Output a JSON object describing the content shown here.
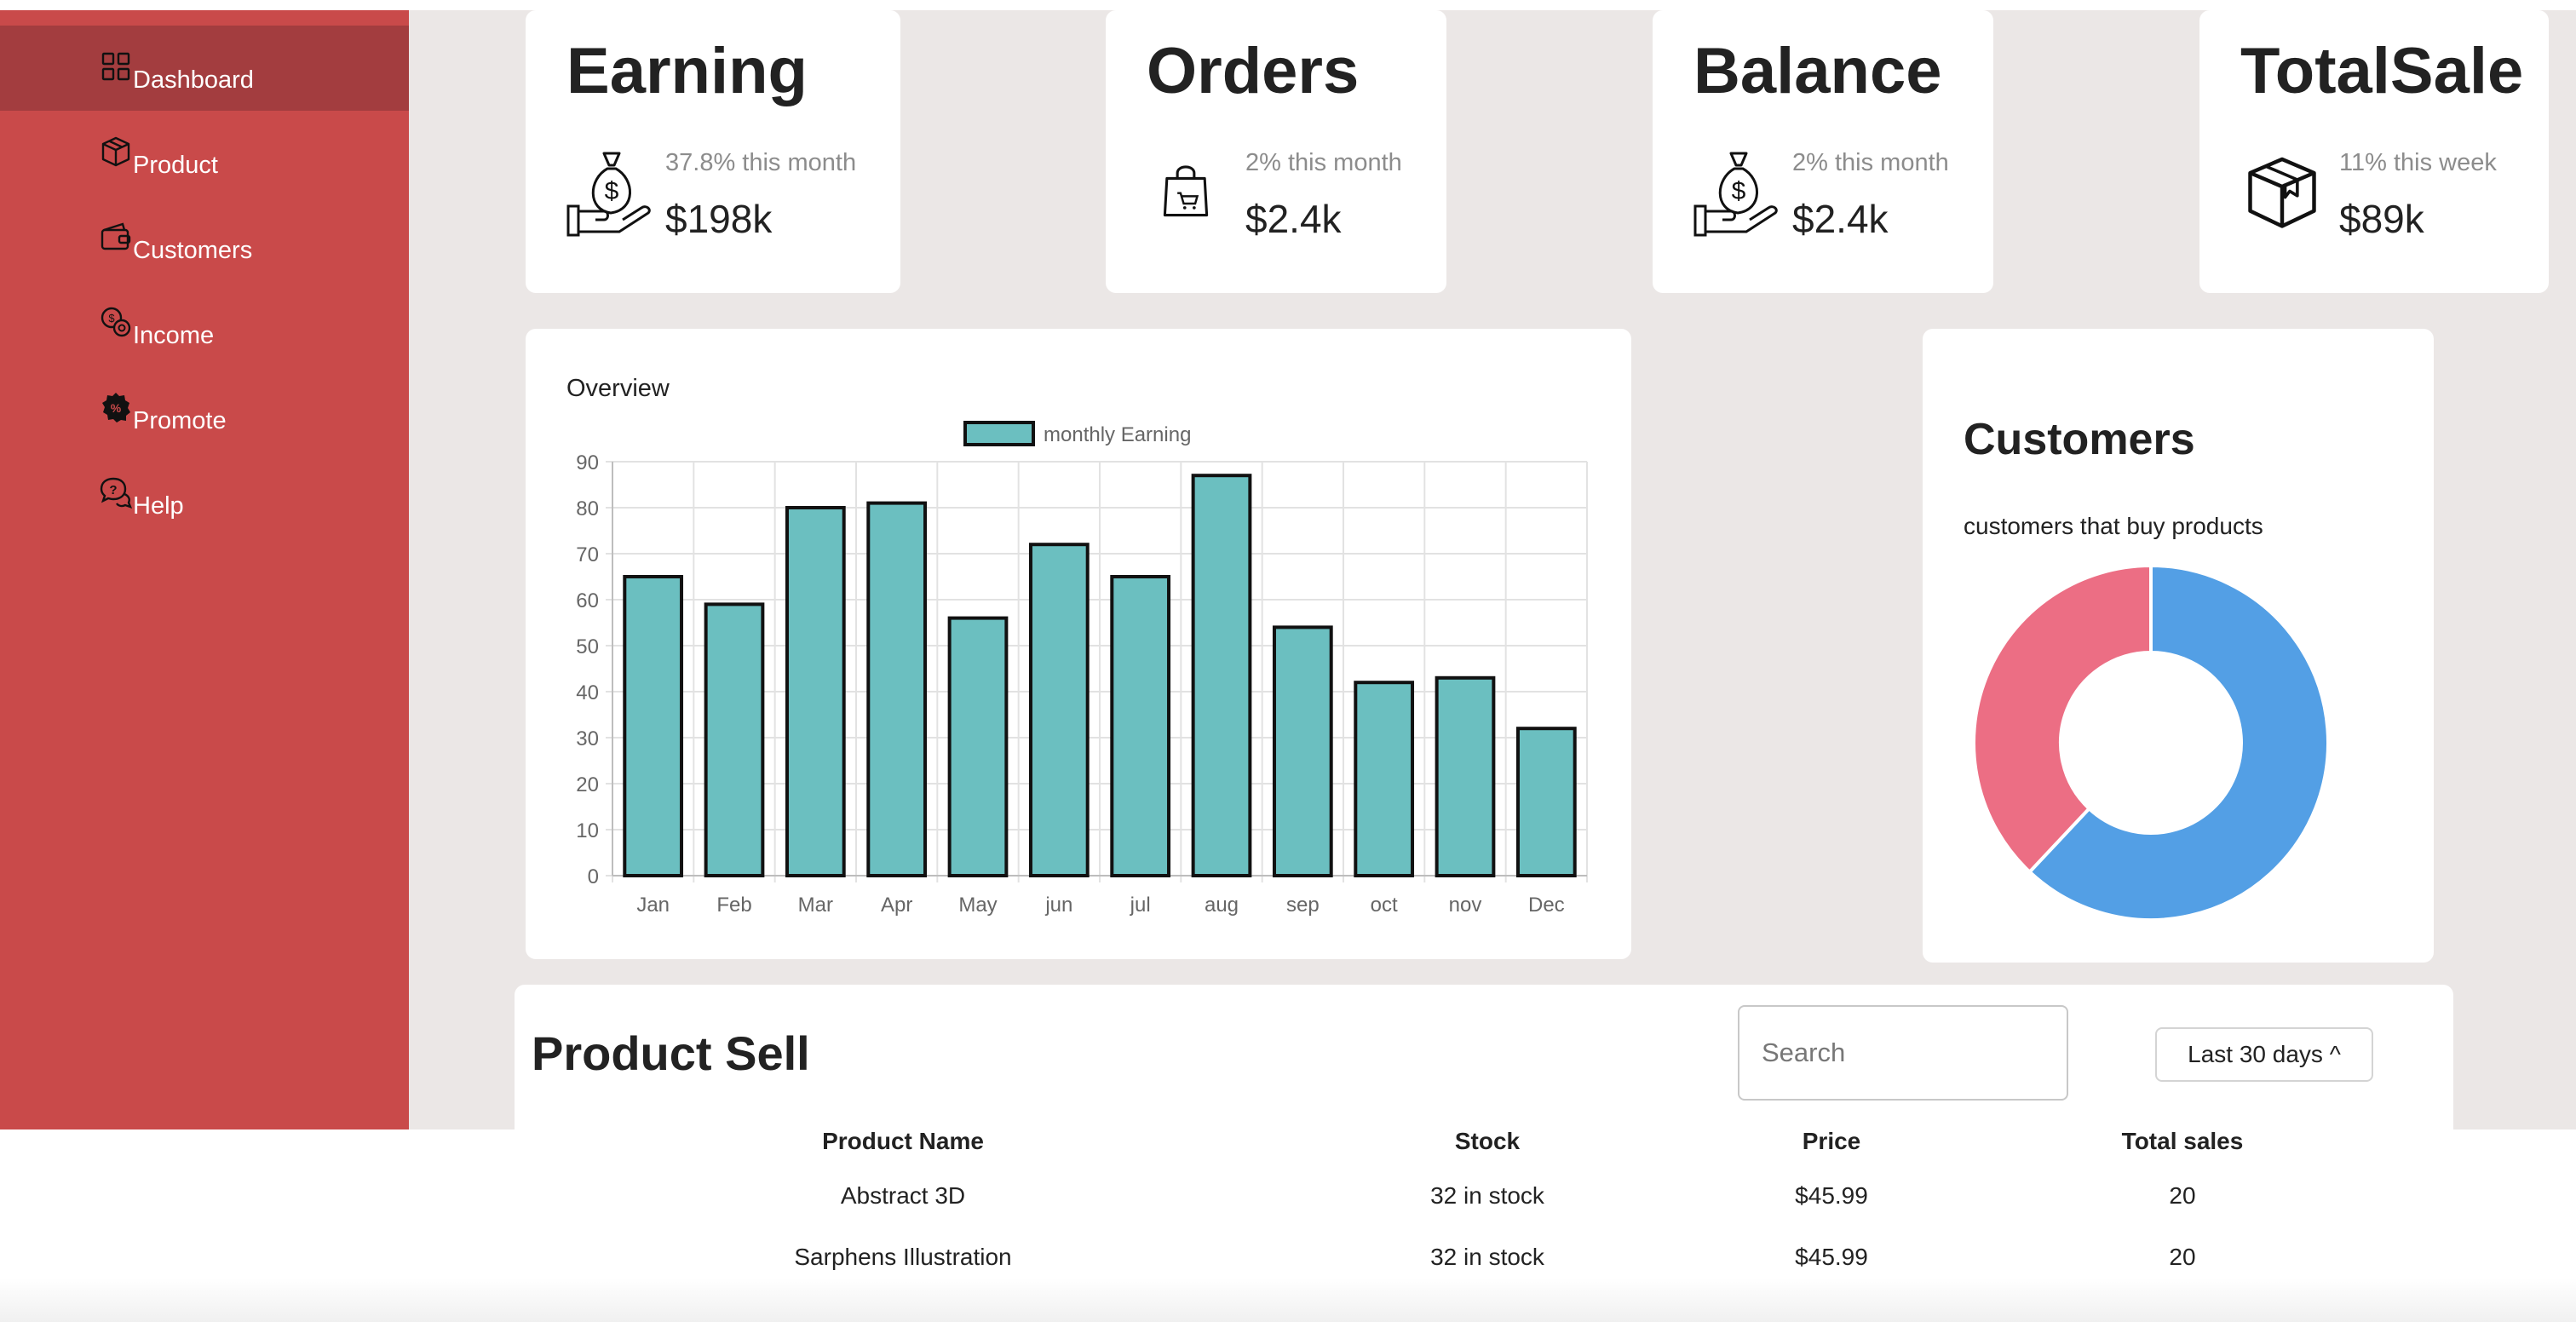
{
  "sidebar": {
    "items": [
      {
        "label": "Dashboard",
        "icon": "dashboard-grid-icon",
        "active": true
      },
      {
        "label": "Product",
        "icon": "cube-box-icon"
      },
      {
        "label": "Customers",
        "icon": "wallet-icon"
      },
      {
        "label": "Income",
        "icon": "dollar-coins-icon"
      },
      {
        "label": "Promote",
        "icon": "discount-badge-icon"
      },
      {
        "label": "Help",
        "icon": "help-chat-icon"
      }
    ],
    "colors": {
      "background": "#c94a4a",
      "active": "#a33d3f"
    }
  },
  "stats": [
    {
      "title": "Earning",
      "subtitle": "37.8% this month",
      "value": "$198k",
      "icon": "money-bag-hand-icon"
    },
    {
      "title": "Orders",
      "subtitle": "2% this month",
      "value": "$2.4k",
      "icon": "shopping-bag-icon"
    },
    {
      "title": "Balance",
      "subtitle": "2% this month",
      "value": "$2.4k",
      "icon": "money-bag-hand-icon"
    },
    {
      "title": "TotalSale",
      "subtitle": "11% this week",
      "value": "$89k",
      "icon": "package-box-icon"
    }
  ],
  "overview": {
    "title": "Overview"
  },
  "chart_data": [
    {
      "type": "bar",
      "categories": [
        "Jan",
        "Feb",
        "Mar",
        "Apr",
        "May",
        "jun",
        "jul",
        "aug",
        "sep",
        "oct",
        "nov",
        "Dec"
      ],
      "series": [
        {
          "name": "monthly Earning",
          "values": [
            65,
            59,
            80,
            81,
            56,
            72,
            65,
            87,
            54,
            42,
            43,
            32
          ],
          "color": "#6bbfc0"
        }
      ],
      "ylim": [
        0,
        90
      ],
      "yticks": [
        0,
        10,
        20,
        30,
        40,
        50,
        60,
        70,
        80,
        90
      ],
      "grid": true,
      "legend": "top-center"
    },
    {
      "type": "pie",
      "title": "Customers",
      "subtitle": "customers that buy products",
      "donut": true,
      "slices": [
        {
          "value": 62,
          "color": "#539fe5"
        },
        {
          "value": 38,
          "color": "#ec6e84"
        }
      ]
    }
  ],
  "customers": {
    "title": "Customers",
    "subtitle": "customers that buy products"
  },
  "product_sell": {
    "title": "Product Sell",
    "search_placeholder": "Search",
    "range_label": "Last 30 days ^",
    "columns": [
      "Product Name",
      "Stock",
      "Price",
      "Total sales"
    ],
    "rows": [
      [
        "Abstract 3D",
        "32 in stock",
        "$45.99",
        "20"
      ],
      [
        "Sarphens Illustration",
        "32 in stock",
        "$45.99",
        "20"
      ]
    ]
  }
}
